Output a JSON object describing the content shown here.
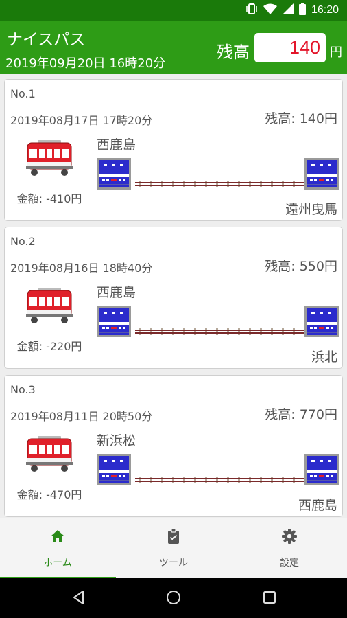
{
  "status_bar": {
    "time": "16:20",
    "icons": [
      "vibrate-icon",
      "wifi-icon",
      "signal-icon",
      "battery-icon"
    ]
  },
  "header": {
    "title": "ナイスパス",
    "datetime": "2019年09月20日 16時20分",
    "balance_label": "残高",
    "balance_value": "140",
    "balance_unit": "円"
  },
  "cards": [
    {
      "no": "No.1",
      "datetime": "2019年08月17日 17時20分",
      "balance": "残高: 140円",
      "amount": "金額: -410円",
      "from": "西鹿島",
      "to": "遠州曳馬"
    },
    {
      "no": "No.2",
      "datetime": "2019年08月16日 18時40分",
      "balance": "残高: 550円",
      "amount": "金額: -220円",
      "from": "西鹿島",
      "to": "浜北"
    },
    {
      "no": "No.3",
      "datetime": "2019年08月11日 20時50分",
      "balance": "残高: 770円",
      "amount": "金額: -470円",
      "from": "新浜松",
      "to": "西鹿島"
    }
  ],
  "bottom_nav": {
    "items": [
      {
        "label": "ホーム",
        "icon": "home-icon",
        "active": true
      },
      {
        "label": "ツール",
        "icon": "clipboard-check-icon",
        "active": false
      },
      {
        "label": "設定",
        "icon": "gear-icon",
        "active": false
      }
    ]
  },
  "colors": {
    "status_bar": "#1a7a0a",
    "app_bar": "#2e9c16",
    "balance_text": "#e3152a",
    "train_body": "#e0202a",
    "station_sign": "#2b2bcc"
  }
}
